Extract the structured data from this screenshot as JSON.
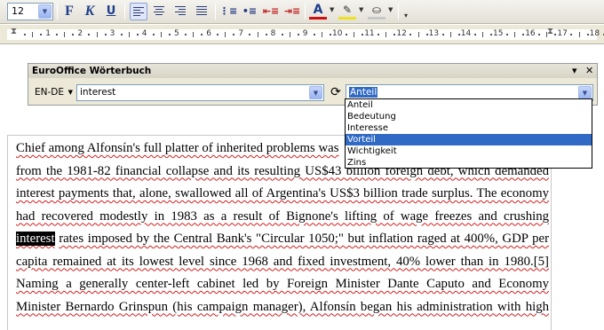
{
  "toolbar": {
    "font_size": "12",
    "bold_icon": "bold-icon",
    "italic_icon": "italic-icon",
    "underline_icon": "underline-icon",
    "bold_label": "F",
    "italic_label": "K",
    "underline_label": "U",
    "align_icons": [
      "align-left-icon",
      "align-center-icon",
      "align-right-icon",
      "justify-icon"
    ],
    "list_icons": [
      "numbered-list-icon",
      "bulleted-list-icon",
      "decrease-indent-icon",
      "increase-indent-icon"
    ],
    "font_color_label": "A",
    "font_color": "#d01010",
    "highlight_color": "#f0e020"
  },
  "ruler": {
    "numbers": [
      "1",
      "2",
      "3",
      "4",
      "5",
      "6",
      "7",
      "8",
      "9",
      "10",
      "11",
      "12",
      "13",
      "14",
      "15",
      "16",
      "17",
      "18"
    ]
  },
  "dictionary": {
    "title": "EuroOffice Wörterbuch",
    "language": "EN-DE",
    "search_value": "interest",
    "result_value": "Anteil",
    "options": [
      "Anteil",
      "Bedeutung",
      "Interesse",
      "Vorteil",
      "Wichtigkeit",
      "Zins"
    ],
    "selected_option": "Vorteil",
    "close_label": "✕",
    "menu_label": "▾"
  },
  "document": {
    "lines": [
      "Chief among Alfonsín's full platter of inherited problems was",
      "from the 1981-82 financial collapse and its resulting US$43 billion foreign debt, which demanded",
      "interest payments that, alone, swallowed all of Argentina's US$3 billion trade surplus. The economy",
      "had recovered modestly in 1983 as a result of Bignone's lifting of wage freezes and crushing",
      "rates imposed by the Central Bank's \"Circular 1050;\" but inflation raged at 400%, GDP per",
      "capita remained at its lowest level since 1968 and fixed investment, 40% lower than in 1980.[5]",
      "Naming a generally center-left cabinet led by Foreign Minister Dante Caputo and Economy",
      "Minister Bernardo Grinspun (his campaign manager), Alfonsín began his administration with high"
    ],
    "highlighted_word": "interest"
  }
}
